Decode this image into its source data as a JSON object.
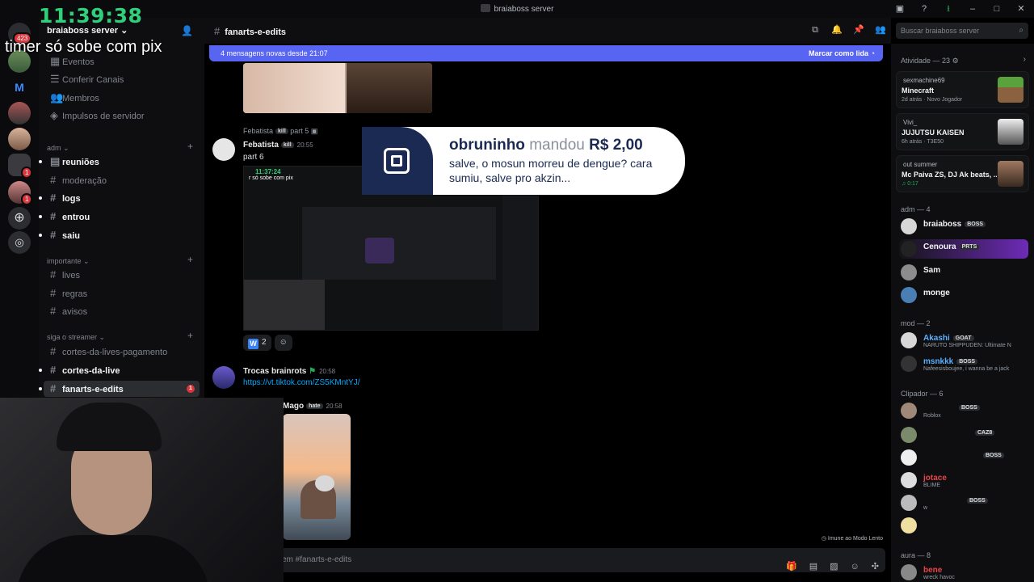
{
  "window": {
    "title": "braiaboss server"
  },
  "overlay": {
    "timer": "11:39:38",
    "caption": "timer só sobe com pix"
  },
  "rail": {
    "badge_main": "423",
    "m_label": "M",
    "badge_a": "1",
    "badge_b": "1"
  },
  "sidebar": {
    "server_name": "braiaboss server",
    "top_items": [
      "Eventos",
      "Conferir Canais",
      "Membros",
      "Impulsos de servidor"
    ],
    "categories": {
      "adm": {
        "label": "adm",
        "channels": [
          "reuniões",
          "moderação",
          "logs",
          "entrou",
          "saiu"
        ]
      },
      "importante": {
        "label": "importante",
        "channels": [
          "lives",
          "regras",
          "avisos"
        ]
      },
      "siga": {
        "label": "siga o streamer",
        "channels": [
          "cortes-da-lives-pagamento",
          "cortes-da-live",
          "fanarts-e-edits"
        ]
      }
    },
    "active_badge": "1"
  },
  "header": {
    "channel": "fanarts-e-edits",
    "search_placeholder": "Buscar braiaboss server"
  },
  "new_messages": {
    "text": "4 mensagens novas desde 21:07",
    "mark_read": "Marcar como lida"
  },
  "messages": {
    "m1": {
      "reply_author": "Febatista",
      "reply_tag": "kill",
      "reply_text": "part 5",
      "author": "Febatista",
      "tag": "kill",
      "time": "20:55",
      "text": "part 6",
      "inner_timer": "11:37:24",
      "inner_caption": "r só sobe com pix"
    },
    "reactions": {
      "w_label": "W",
      "w_count": "2"
    },
    "m2": {
      "author": "Trocas brainrots",
      "time": "20:58",
      "link": "https://vt.tiktok.com/ZS5KMntYJ/"
    },
    "m3": {
      "author": "Mago",
      "tag": "hate",
      "time": "20:58"
    }
  },
  "immune": "Imune ao Modo Lento",
  "composer": {
    "placeholder": "em #fanarts-e-edits"
  },
  "donation": {
    "name": "obruninho",
    "verb": "mandou",
    "amount": "R$ 2,00",
    "message": "salve, o mosun morreu de dengue? cara sumiu, salve pro akzin..."
  },
  "activity": {
    "header": "Atividade — 23",
    "cards": [
      {
        "user": "sexmachine69",
        "title": "Minecraft",
        "meta": "2d atrás",
        "extra": "Novo Jogador"
      },
      {
        "user": "Vivi_",
        "title": "JUJUTSU KAISEN",
        "meta": "6h atrás",
        "extra": "T3E50"
      },
      {
        "user": "out summer",
        "title": "Mc Paiva ZS, DJ Ak beats, ...",
        "meta": "0:17",
        "extra": ""
      }
    ]
  },
  "members": {
    "adm": {
      "label": "adm — 4",
      "list": [
        {
          "name": "braiaboss",
          "tag": "BOSS"
        },
        {
          "name": "Cenoura",
          "tag": "PRTS"
        },
        {
          "name": "Sam",
          "tag": ""
        },
        {
          "name": "monge",
          "tag": ""
        }
      ]
    },
    "mod": {
      "label": "mod — 2",
      "list": [
        {
          "name": "Akashi",
          "tag": "GOAT",
          "status": "NARUTO SHIPPUDEN: Ultimate N"
        },
        {
          "name": "msnkkk",
          "tag": "BOSS",
          "status": "Nafeesisboujee, i wanna be a jack"
        }
      ]
    },
    "clipador": {
      "label": "Clipador — 6",
      "list": [
        {
          "name": "",
          "tag": "BOSS",
          "status": "Roblox"
        },
        {
          "name": "",
          "tag": "CAZ8",
          "status": ""
        },
        {
          "name": "",
          "tag": "BOSS",
          "status": ""
        },
        {
          "name": "jotace",
          "tag": "",
          "status": "BLIME"
        },
        {
          "name": "",
          "tag": "BOSS",
          "status": "w"
        },
        {
          "name": "",
          "tag": "",
          "status": ""
        }
      ]
    },
    "aura": {
      "label": "aura — 8",
      "list": [
        {
          "name": "bene",
          "status": "wreck havoc"
        }
      ]
    }
  },
  "colors": {
    "accent": "#5865f2",
    "timer": "#2fd07a",
    "link": "#00a8fc",
    "danger": "#da373c"
  }
}
